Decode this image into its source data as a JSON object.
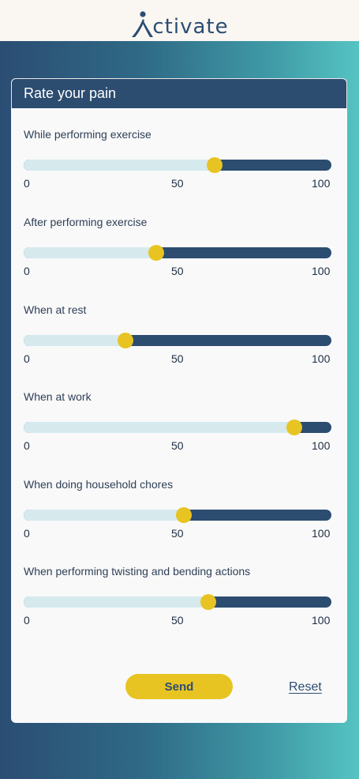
{
  "app": {
    "logo_text": "ctivate"
  },
  "card": {
    "title": "Rate your pain"
  },
  "scale": {
    "min": "0",
    "mid": "50",
    "max": "100"
  },
  "questions": [
    {
      "label": "While performing exercise",
      "value": 62
    },
    {
      "label": "After performing exercise",
      "value": 43
    },
    {
      "label": "When at rest",
      "value": 33
    },
    {
      "label": "When at work",
      "value": 88
    },
    {
      "label": "When doing household chores",
      "value": 52
    },
    {
      "label": "When performing twisting and bending actions",
      "value": 60
    }
  ],
  "actions": {
    "send_label": "Send",
    "reset_label": "Reset"
  },
  "colors": {
    "primary": "#2c4c70",
    "accent": "#e8c422",
    "track_fill": "#d6eaee"
  }
}
